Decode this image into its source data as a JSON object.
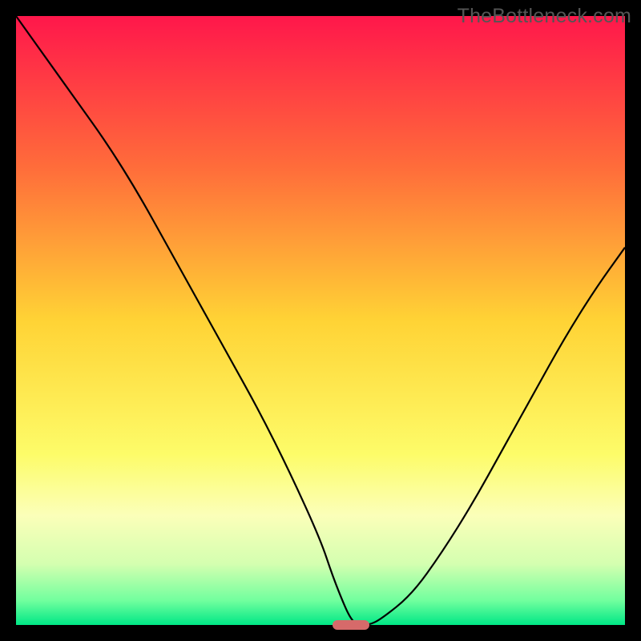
{
  "branding": {
    "watermark": "TheBottleneck.com"
  },
  "chart_data": {
    "type": "line",
    "title": "",
    "xlabel": "",
    "ylabel": "",
    "xlim": [
      0,
      100
    ],
    "ylim": [
      0,
      100
    ],
    "grid": false,
    "legend": false,
    "x": [
      0,
      5,
      10,
      15,
      20,
      25,
      30,
      35,
      40,
      45,
      50,
      52,
      54,
      55,
      56,
      58,
      60,
      65,
      70,
      75,
      80,
      85,
      90,
      95,
      100
    ],
    "values": [
      100,
      93,
      86,
      79,
      71,
      62,
      53,
      44,
      35,
      25,
      14,
      8,
      3,
      1,
      0,
      0,
      1,
      5,
      12,
      20,
      29,
      38,
      47,
      55,
      62
    ],
    "marker": {
      "x": 55,
      "y": 0,
      "w": 6,
      "h": 1.5,
      "color": "#d66a6a"
    },
    "background_gradient": [
      {
        "stop": 0,
        "color": "#ff174b"
      },
      {
        "stop": 25,
        "color": "#ff6d3a"
      },
      {
        "stop": 50,
        "color": "#ffd335"
      },
      {
        "stop": 72,
        "color": "#fdfc69"
      },
      {
        "stop": 82,
        "color": "#fbffb9"
      },
      {
        "stop": 90,
        "color": "#d4ffb0"
      },
      {
        "stop": 96,
        "color": "#71ff9e"
      },
      {
        "stop": 100,
        "color": "#00e786"
      }
    ]
  }
}
